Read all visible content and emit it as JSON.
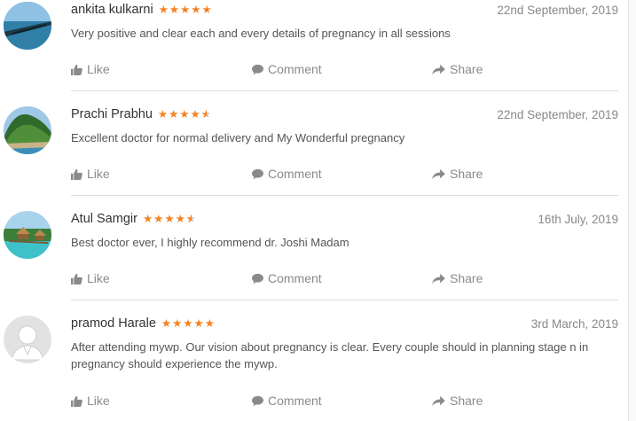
{
  "reviews": [
    {
      "name": "ankita kulkarni",
      "stars": "full5",
      "date": "22nd September, 2019",
      "text": "Very positive and clear each and every details of pregnancy in all sessions",
      "avatar": "sea-pier-photo"
    },
    {
      "name": "Prachi Prabhu",
      "stars": "4.5",
      "date": "22nd September, 2019",
      "text": "Excellent doctor for normal delivery and My Wonderful pregnancy",
      "avatar": "tropical-island-photo"
    },
    {
      "name": "Atul Samgir",
      "stars": "4.5",
      "date": "16th July, 2019",
      "text": "Best doctor ever, I highly recommend dr. Joshi Madam",
      "avatar": "beach-huts-photo"
    },
    {
      "name": "pramod Harale",
      "stars": "full5",
      "date": "3rd March, 2019",
      "text": "After attending mywp. Our vision about pregnancy is clear. Every couple should in planning stage n in pregnancy should experience the mywp.",
      "avatar": "default-user-avatar"
    }
  ],
  "actions": {
    "like": "Like",
    "comment": "Comment",
    "share": "Share"
  },
  "colors": {
    "star": "#f58220",
    "action": "#8a8a8a",
    "divider": "#dcdcdc"
  }
}
